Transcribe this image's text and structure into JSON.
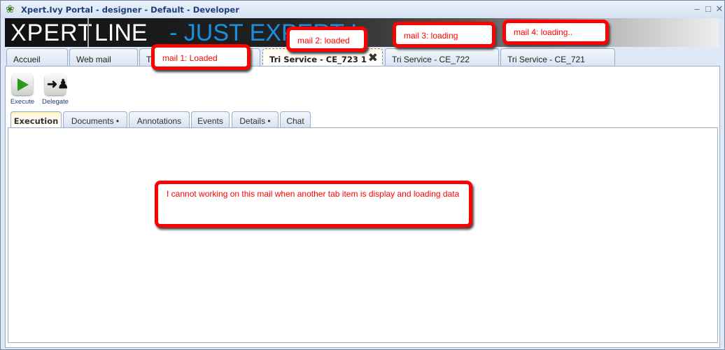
{
  "window": {
    "title": "Xpert.Ivy Portal  - designer - Default - Developer",
    "app_icon": "ivy-leaf-icon",
    "controls": [
      "minimize",
      "maximize",
      "close"
    ]
  },
  "banner": {
    "logo_left": "XPERT",
    "logo_right": "LINE",
    "slogan": "- JUST EXPERT !"
  },
  "main_tabs": [
    {
      "label": "Accueil"
    },
    {
      "label": "Web mail"
    },
    {
      "label": "Tr"
    },
    {
      "label": "Tri Service - CE_723 1",
      "active": true,
      "closable": true
    },
    {
      "label": "Tri Service - CE_722"
    },
    {
      "label": "Tri Service - CE_721"
    }
  ],
  "toolbar": {
    "execute": "Execute",
    "delegate": "Delegate"
  },
  "sub_tabs": [
    {
      "label": "Execution",
      "active": true
    },
    {
      "label": "Documents •"
    },
    {
      "label": "Annotations"
    },
    {
      "label": "Events"
    },
    {
      "label": "Details •"
    },
    {
      "label": "Chat"
    }
  ],
  "callouts": {
    "mail1": "mail 1: Loaded",
    "mail2": "mail 2: loaded",
    "mail3": "mail 3: loading",
    "mail4": "mail 4: loading..",
    "note": "I cannot working on this mail when another tab item is display and loading data"
  },
  "colors": {
    "callout": "#ff0000",
    "slogan": "#1a8fe0",
    "title": "#1f3f7a"
  }
}
